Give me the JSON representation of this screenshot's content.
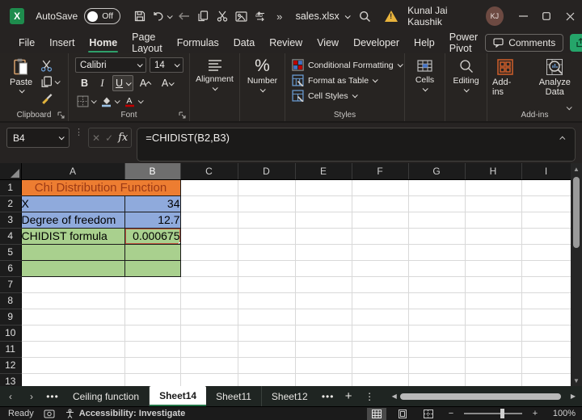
{
  "titlebar": {
    "autosave_label": "AutoSave",
    "autosave_state": "Off",
    "overflow": "»",
    "filename": "sales.xlsx",
    "user_name": "Kunal Jai Kaushik",
    "user_initials": "KJ"
  },
  "menu": {
    "tabs": [
      "File",
      "Insert",
      "Home",
      "Page Layout",
      "Formulas",
      "Data",
      "Review",
      "View",
      "Developer",
      "Help",
      "Power Pivot"
    ],
    "active_tab": "Home",
    "comments_label": "Comments"
  },
  "ribbon": {
    "paste_label": "Paste",
    "clipboard_group": "Clipboard",
    "font_name": "Calibri",
    "font_size": "14",
    "bold": "B",
    "italic": "I",
    "underline": "U",
    "font_group": "Font",
    "alignment_label": "Alignment",
    "number_label": "Number",
    "percent": "%",
    "conditional_formatting": "Conditional Formatting",
    "format_as_table": "Format as Table",
    "cell_styles": "Cell Styles",
    "styles_group": "Styles",
    "cells_label": "Cells",
    "editing_label": "Editing",
    "addins_label": "Add-ins",
    "analyze_data_label": "Analyze Data",
    "addins_group": "Add-ins"
  },
  "formula_bar": {
    "name_box": "B4",
    "fx_label": "fx",
    "formula": "=CHIDIST(B2,B3)"
  },
  "grid": {
    "columns": [
      "A",
      "B",
      "C",
      "D",
      "E",
      "F",
      "G",
      "H",
      "I"
    ],
    "selected_column": "B",
    "selected_cell": "B4",
    "rows": [
      "1",
      "2",
      "3",
      "4",
      "5",
      "6",
      "7",
      "8",
      "9",
      "10",
      "11",
      "12",
      "13"
    ],
    "cells": {
      "title": "Chi Distribution Function",
      "a2": "X",
      "b2": "34",
      "a3": "Degree of freedom",
      "b3": "12.7",
      "a4": "CHIDIST formula",
      "b4": "0.000675"
    }
  },
  "sheet_tabs": {
    "tabs": [
      "Ceiling function",
      "Sheet14",
      "Sheet11",
      "Sheet12"
    ],
    "active": "Sheet14"
  },
  "status_bar": {
    "ready": "Ready",
    "accessibility": "Accessibility: Investigate",
    "zoom_level": "100%"
  },
  "colors": {
    "accent_green": "#217346",
    "tab_underline_green": "#2EA06A",
    "share_button_green": "#25A56A",
    "header_orange": "#ED7D31",
    "header_orange_text": "#9C3A16",
    "input_blue": "#8FAADC",
    "result_green": "#A9D08E",
    "selection_border": "#C65A41",
    "warning_yellow": "#E8B33C",
    "avatar_brown": "#6D4A42"
  }
}
